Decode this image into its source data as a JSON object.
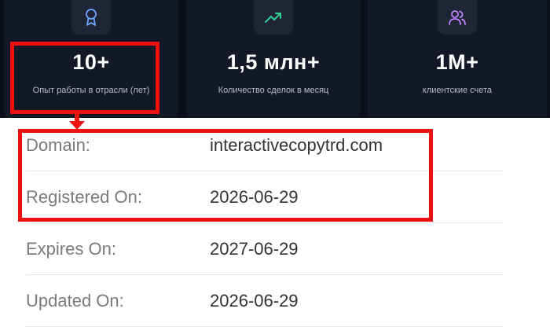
{
  "stats": [
    {
      "icon": "award-icon",
      "value": "10+",
      "label": "Опыт работы в отрасли (лет)"
    },
    {
      "icon": "trending-up-icon",
      "value": "1,5 млн+",
      "label": "Количество сделок в месяц"
    },
    {
      "icon": "users-icon",
      "value": "1M+",
      "label": "клиентские счета"
    }
  ],
  "whois": [
    {
      "key": "Domain:",
      "value": "interactivecopytrd.com"
    },
    {
      "key": "Registered On:",
      "value": "2026-06-29"
    },
    {
      "key": "Expires On:",
      "value": "2027-06-29"
    },
    {
      "key": "Updated On:",
      "value": "2026-06-29"
    }
  ],
  "colors": {
    "highlight": "#ee1111",
    "dark_bg": "#0b0f1a",
    "card_bg": "#121826",
    "award_icon": "#6ea8ff",
    "trend_icon": "#34d399",
    "users_icon": "#c084fc"
  }
}
